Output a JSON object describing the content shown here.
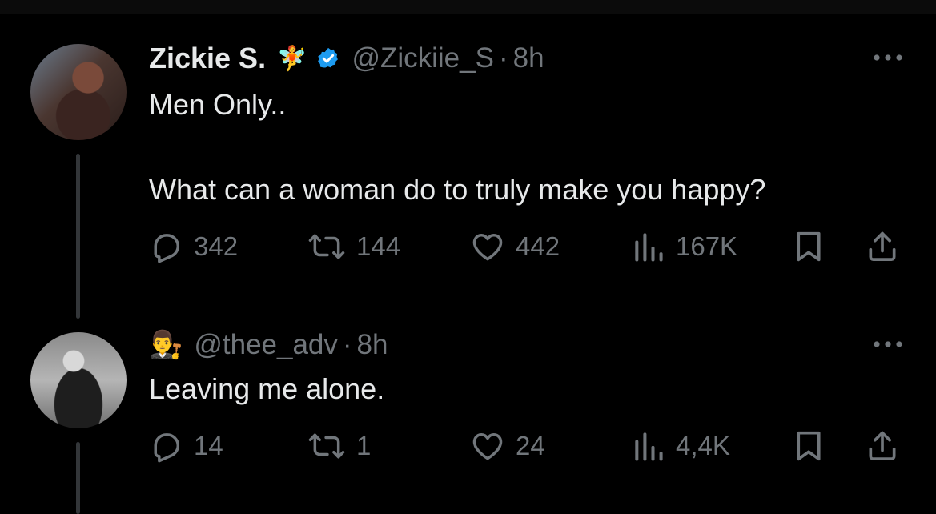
{
  "tweet1": {
    "name": "Zickie S.",
    "name_emoji": "🧚",
    "handle": "@Zickiie_S",
    "separator": "·",
    "time": "8h",
    "text_line1": "Men Only..",
    "text_line2": "What can a woman do to truly make you happy?",
    "replies": "342",
    "retweets": "144",
    "likes": "442",
    "views": "167K"
  },
  "tweet2": {
    "emoji": "👨‍⚖️",
    "handle": "@thee_adv",
    "separator": "·",
    "time": "8h",
    "text": "Leaving me alone.",
    "replies": "14",
    "retweets": "1",
    "likes": "24",
    "views": "4,4K"
  },
  "colors": {
    "background": "#000000",
    "text_primary": "#e7e9ea",
    "text_secondary": "#71767b",
    "verified_blue": "#1d9bf0",
    "thread_line": "#333639"
  }
}
